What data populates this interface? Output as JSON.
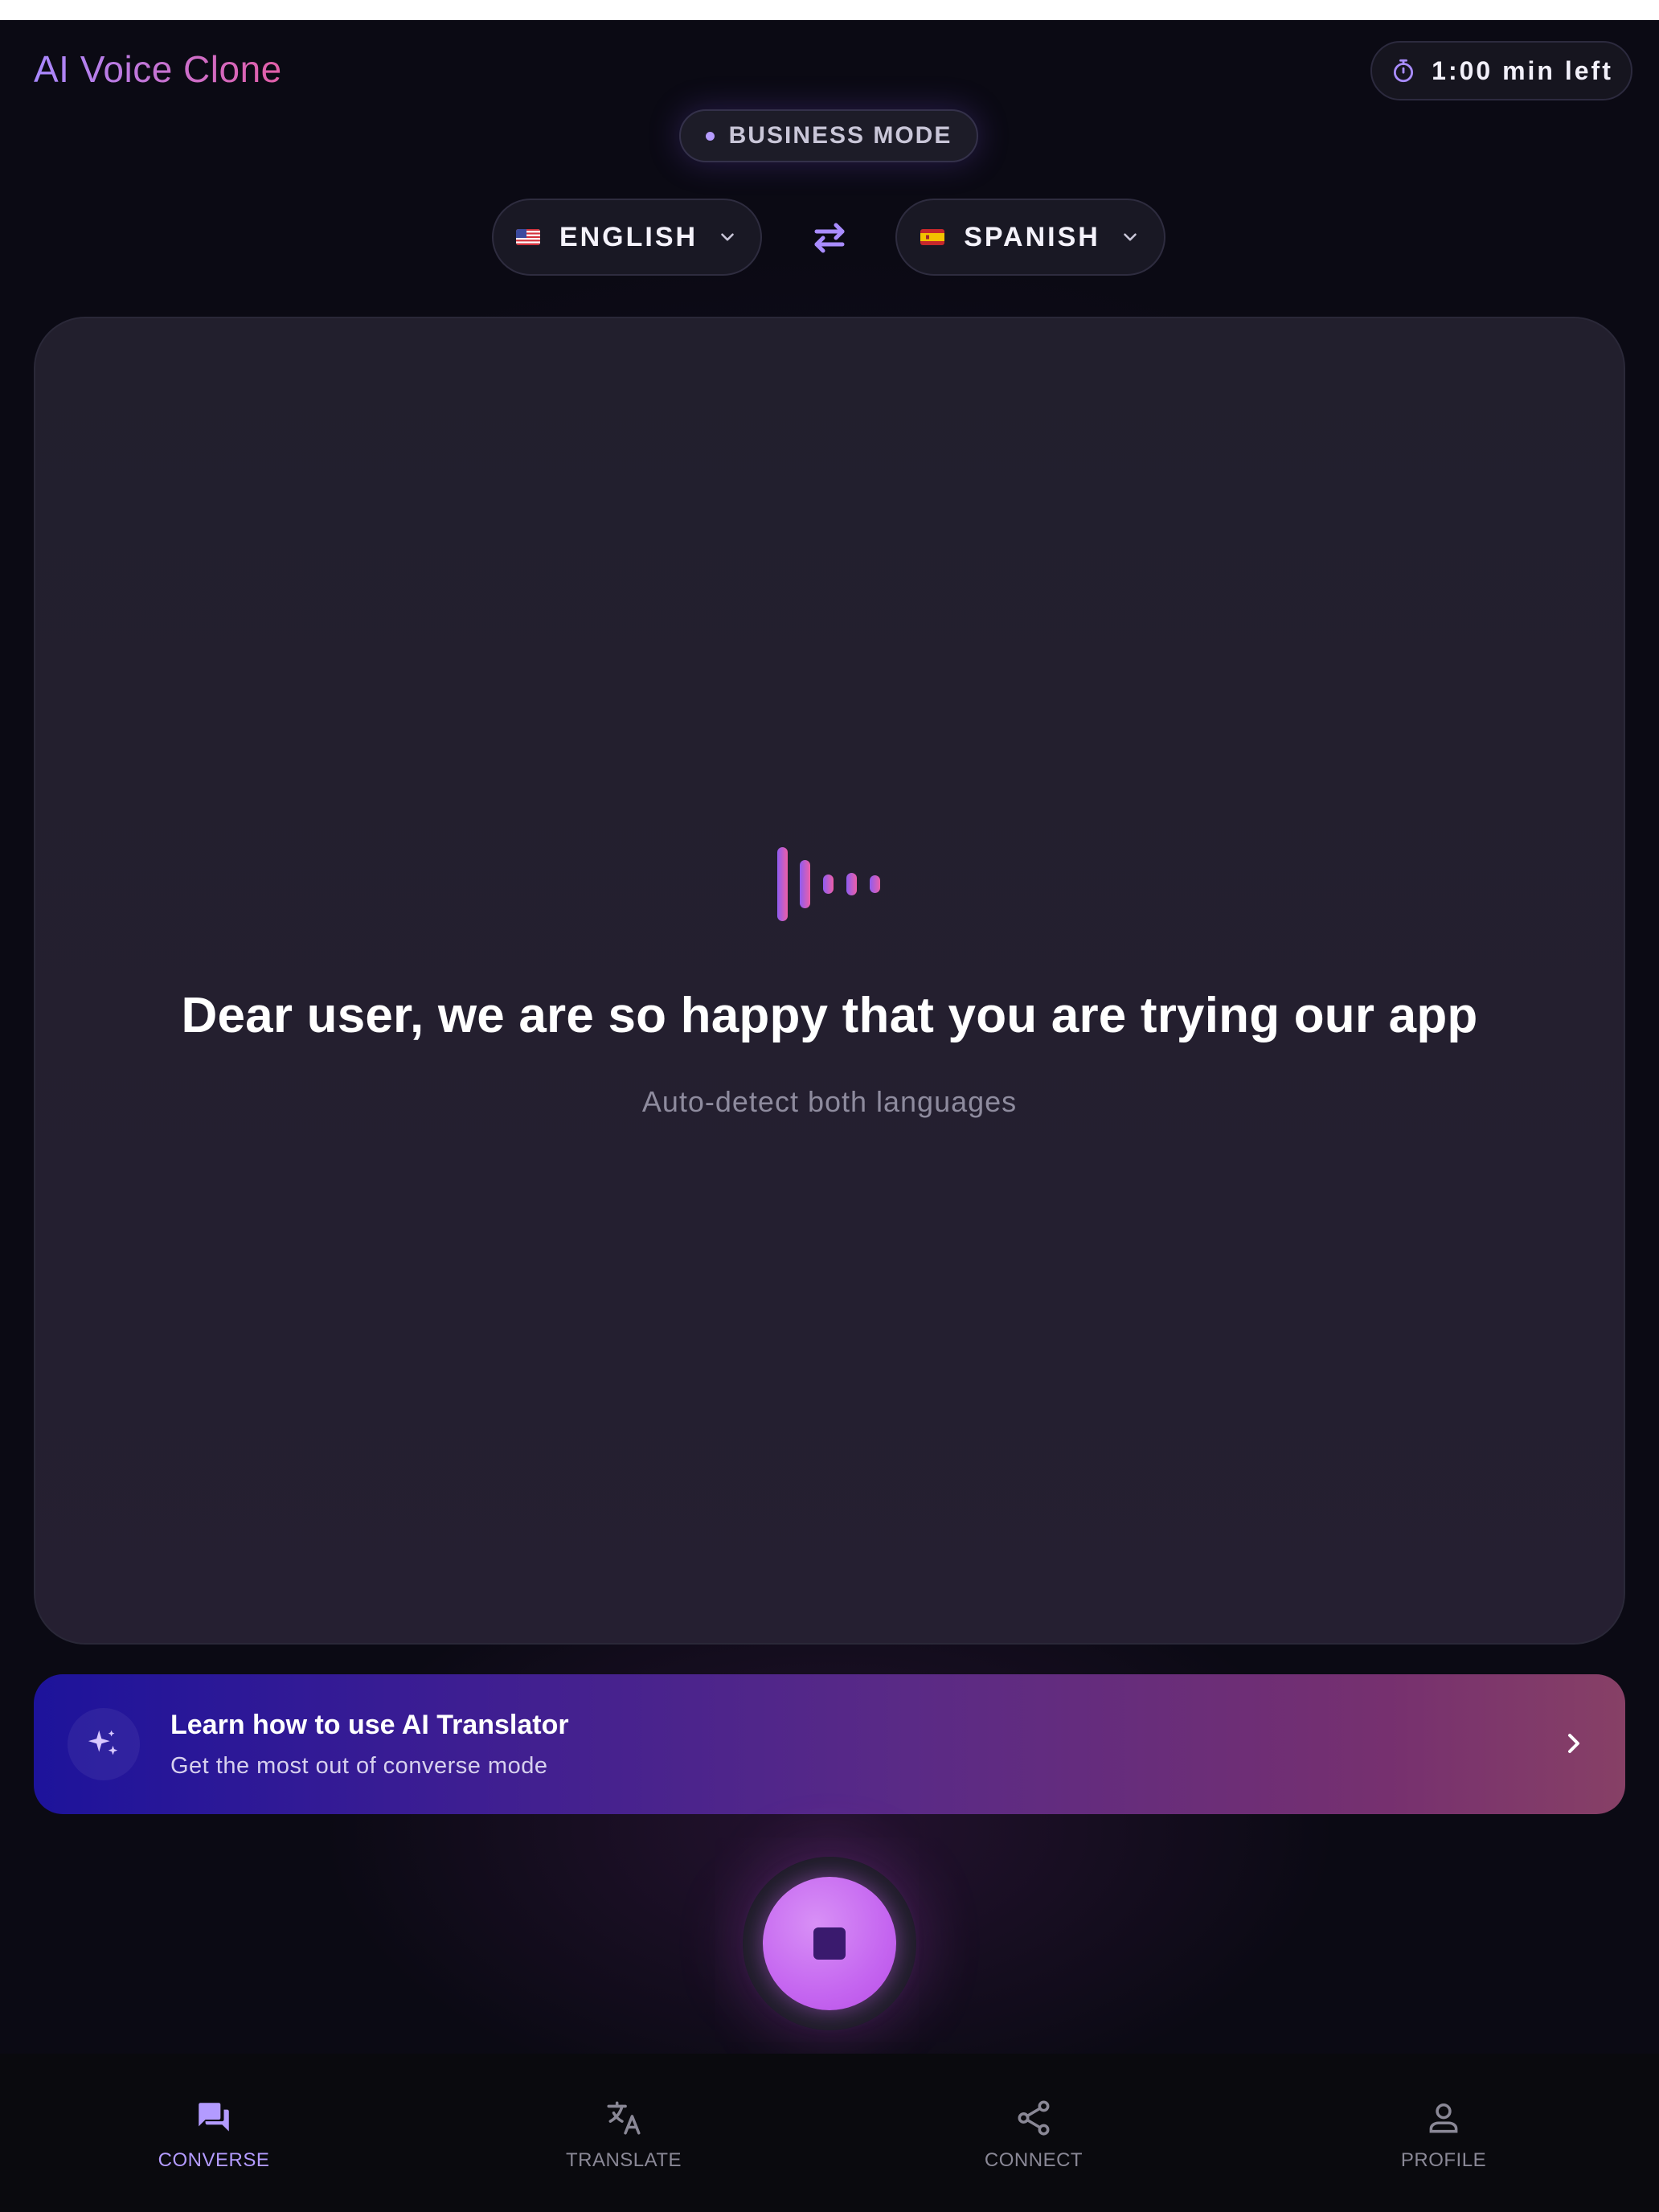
{
  "app": {
    "title": "AI Voice Clone"
  },
  "timer": {
    "label": "1:00 min left",
    "icon": "stopwatch-icon"
  },
  "mode": {
    "label": "BUSINESS MODE"
  },
  "languages": {
    "source": {
      "label": "ENGLISH",
      "flag": "us-flag-icon"
    },
    "target": {
      "label": "SPANISH",
      "flag": "es-flag-icon"
    },
    "swap_icon": "swap-arrows-icon"
  },
  "card": {
    "icon": "audio-wave-icon",
    "greeting": "Dear user, we are so happy that you are trying our app",
    "subtitle": "Auto-detect both languages"
  },
  "banner": {
    "title": "Learn how to use AI Translator",
    "subtitle": "Get the most out of converse mode",
    "icon": "sparkles-icon"
  },
  "record_button": {
    "state": "recording",
    "icon": "stop-icon"
  },
  "nav": {
    "items": [
      {
        "label": "CONVERSE",
        "icon": "chat-bubbles-icon",
        "active": true
      },
      {
        "label": "TRANSLATE",
        "icon": "translate-icon",
        "active": false
      },
      {
        "label": "CONNECT",
        "icon": "share-icon",
        "active": false
      },
      {
        "label": "PROFILE",
        "icon": "person-icon",
        "active": false
      }
    ]
  },
  "colors": {
    "background": "#0b0a14",
    "accent": "#b39bff",
    "accent_pink": "#e35ea8",
    "record": "#c566f0"
  }
}
